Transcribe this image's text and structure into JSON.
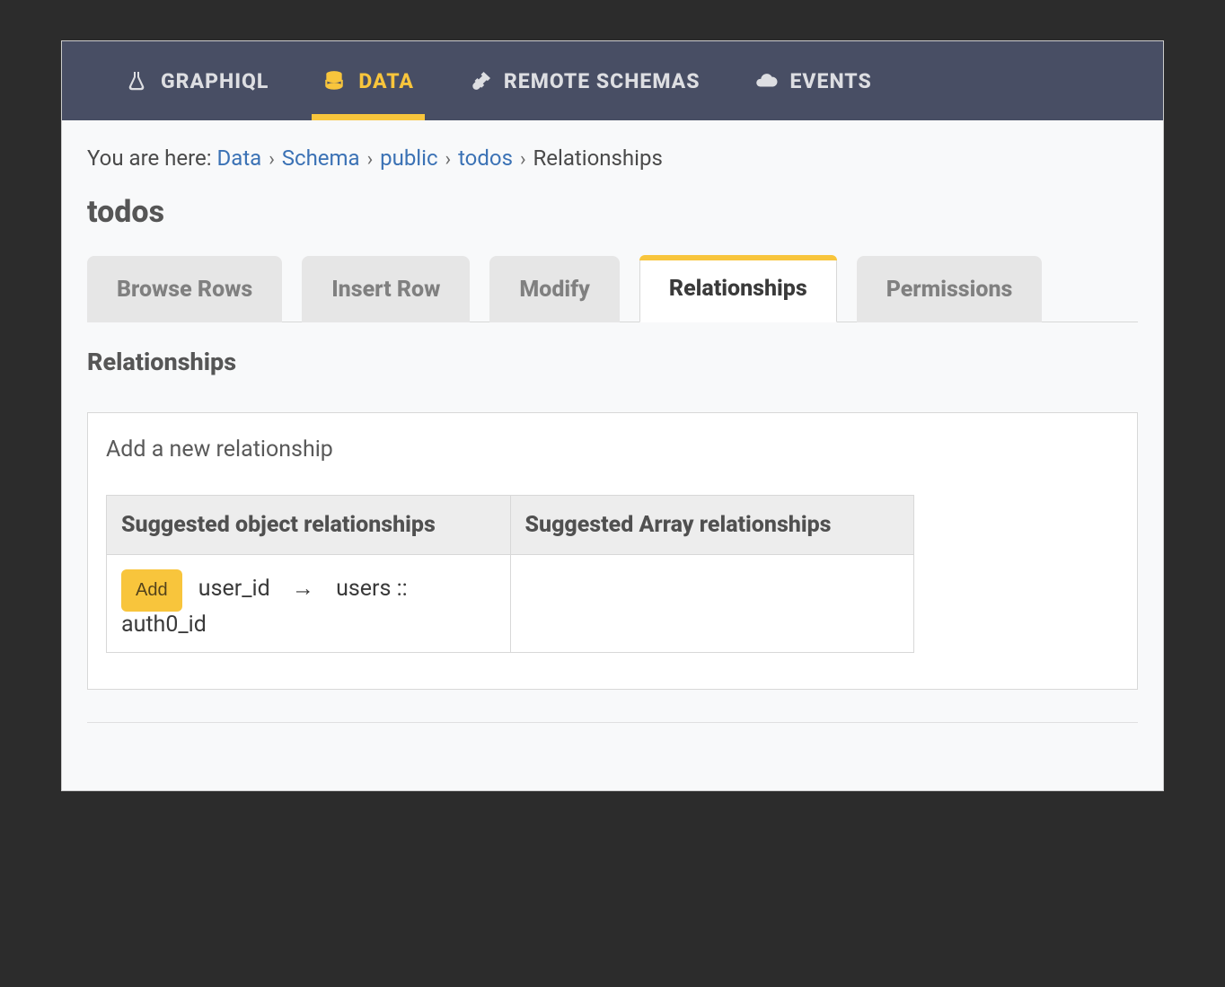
{
  "nav": {
    "items": [
      {
        "label": "GRAPHIQL",
        "icon": "flask-icon",
        "active": false
      },
      {
        "label": "DATA",
        "icon": "database-icon",
        "active": true
      },
      {
        "label": "REMOTE SCHEMAS",
        "icon": "plug-icon",
        "active": false
      },
      {
        "label": "EVENTS",
        "icon": "cloud-icon",
        "active": false
      }
    ]
  },
  "breadcrumb": {
    "prefix": "You are here: ",
    "items": [
      {
        "label": "Data",
        "link": true
      },
      {
        "label": "Schema",
        "link": true
      },
      {
        "label": "public",
        "link": true
      },
      {
        "label": "todos",
        "link": true
      },
      {
        "label": "Relationships",
        "link": false
      }
    ],
    "sep": "›"
  },
  "page": {
    "title": "todos"
  },
  "tabs": [
    {
      "label": "Browse Rows",
      "active": false
    },
    {
      "label": "Insert Row",
      "active": false
    },
    {
      "label": "Modify",
      "active": false
    },
    {
      "label": "Relationships",
      "active": true
    },
    {
      "label": "Permissions",
      "active": false
    }
  ],
  "section": {
    "title": "Relationships",
    "add_heading": "Add a new relationship",
    "table": {
      "headers": {
        "object": "Suggested object relationships",
        "array": "Suggested Array relationships"
      },
      "object_rows": [
        {
          "add_label": "Add",
          "from_column": "user_id",
          "target": "users :: auth0_id"
        }
      ],
      "array_rows": []
    }
  }
}
